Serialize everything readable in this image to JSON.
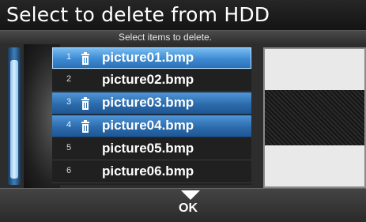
{
  "header": {
    "title": "Select to delete from HDD"
  },
  "subheader": {
    "instruction": "Select items to delete."
  },
  "list": {
    "items": [
      {
        "number": "1",
        "name": "picture01.bmp",
        "marked": true
      },
      {
        "number": "2",
        "name": "picture02.bmp",
        "marked": false
      },
      {
        "number": "3",
        "name": "picture03.bmp",
        "marked": true
      },
      {
        "number": "4",
        "name": "picture04.bmp",
        "marked": true
      },
      {
        "number": "5",
        "name": "picture05.bmp",
        "marked": false
      },
      {
        "number": "6",
        "name": "picture06.bmp",
        "marked": false
      }
    ]
  },
  "footer": {
    "ok_label": "OK"
  },
  "colors": {
    "selected": "#2c6cad",
    "cursor": "#3c8ad2",
    "background": "#1b1b1b"
  },
  "icons": {
    "marked_item": "trash-icon",
    "ok": "down-arrow-icon"
  }
}
